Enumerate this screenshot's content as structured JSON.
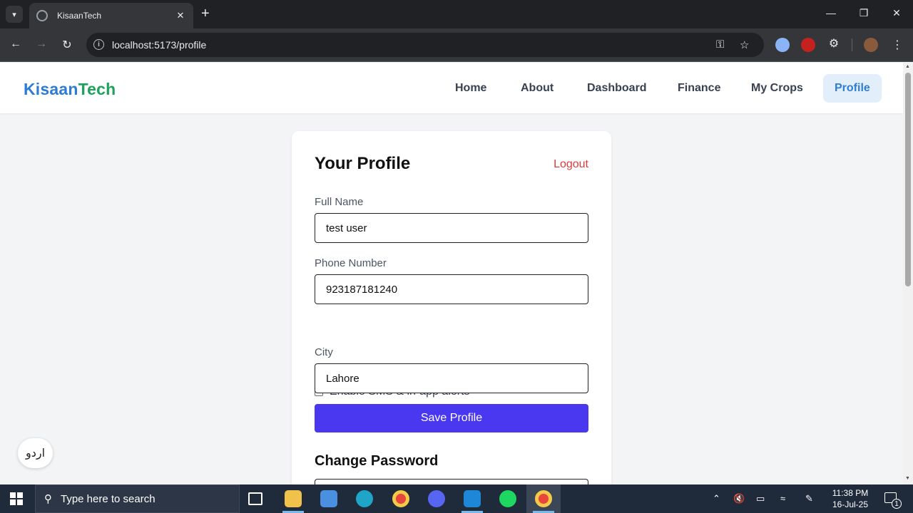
{
  "browser": {
    "tab_title": "KisaanTech",
    "tab_close": "✕",
    "new_tab": "+",
    "url": "localhost:5173/profile",
    "window_controls": [
      "minimize-icon",
      "restore-icon",
      "close-icon"
    ]
  },
  "site": {
    "logo_part1": "Kisaan",
    "logo_part2": "Tech",
    "nav": [
      {
        "label": "Home",
        "active": false
      },
      {
        "label": "About",
        "active": false
      },
      {
        "label": "Dashboard",
        "active": false
      },
      {
        "label": "Finance",
        "active": false
      },
      {
        "label": "My Crops",
        "active": false
      },
      {
        "label": "Profile",
        "active": true
      }
    ]
  },
  "profile": {
    "title": "Your Profile",
    "logout": "Logout",
    "full_name_label": "Full Name",
    "full_name_value": "test user",
    "phone_label": "Phone Number",
    "phone_value": "923187181240",
    "alerts_label": "Enable SMS & in-app alerts",
    "alerts_checked": false,
    "city_label": "City",
    "city_value": "Lahore",
    "save_button": "Save Profile",
    "change_password_title": "Change Password"
  },
  "language_toggle": "اردو",
  "taskbar": {
    "search_placeholder": "Type here to search",
    "time": "11:38 PM",
    "date": "16-Jul-25",
    "notification_count": "1"
  },
  "colors": {
    "logo_blue": "#2e7bd6",
    "logo_green": "#1ba45a",
    "nav_active_bg": "#e3eefb",
    "nav_active_text": "#2f7fd1",
    "logout_red": "#e03a3a",
    "save_button_bg": "#4a37f0"
  }
}
